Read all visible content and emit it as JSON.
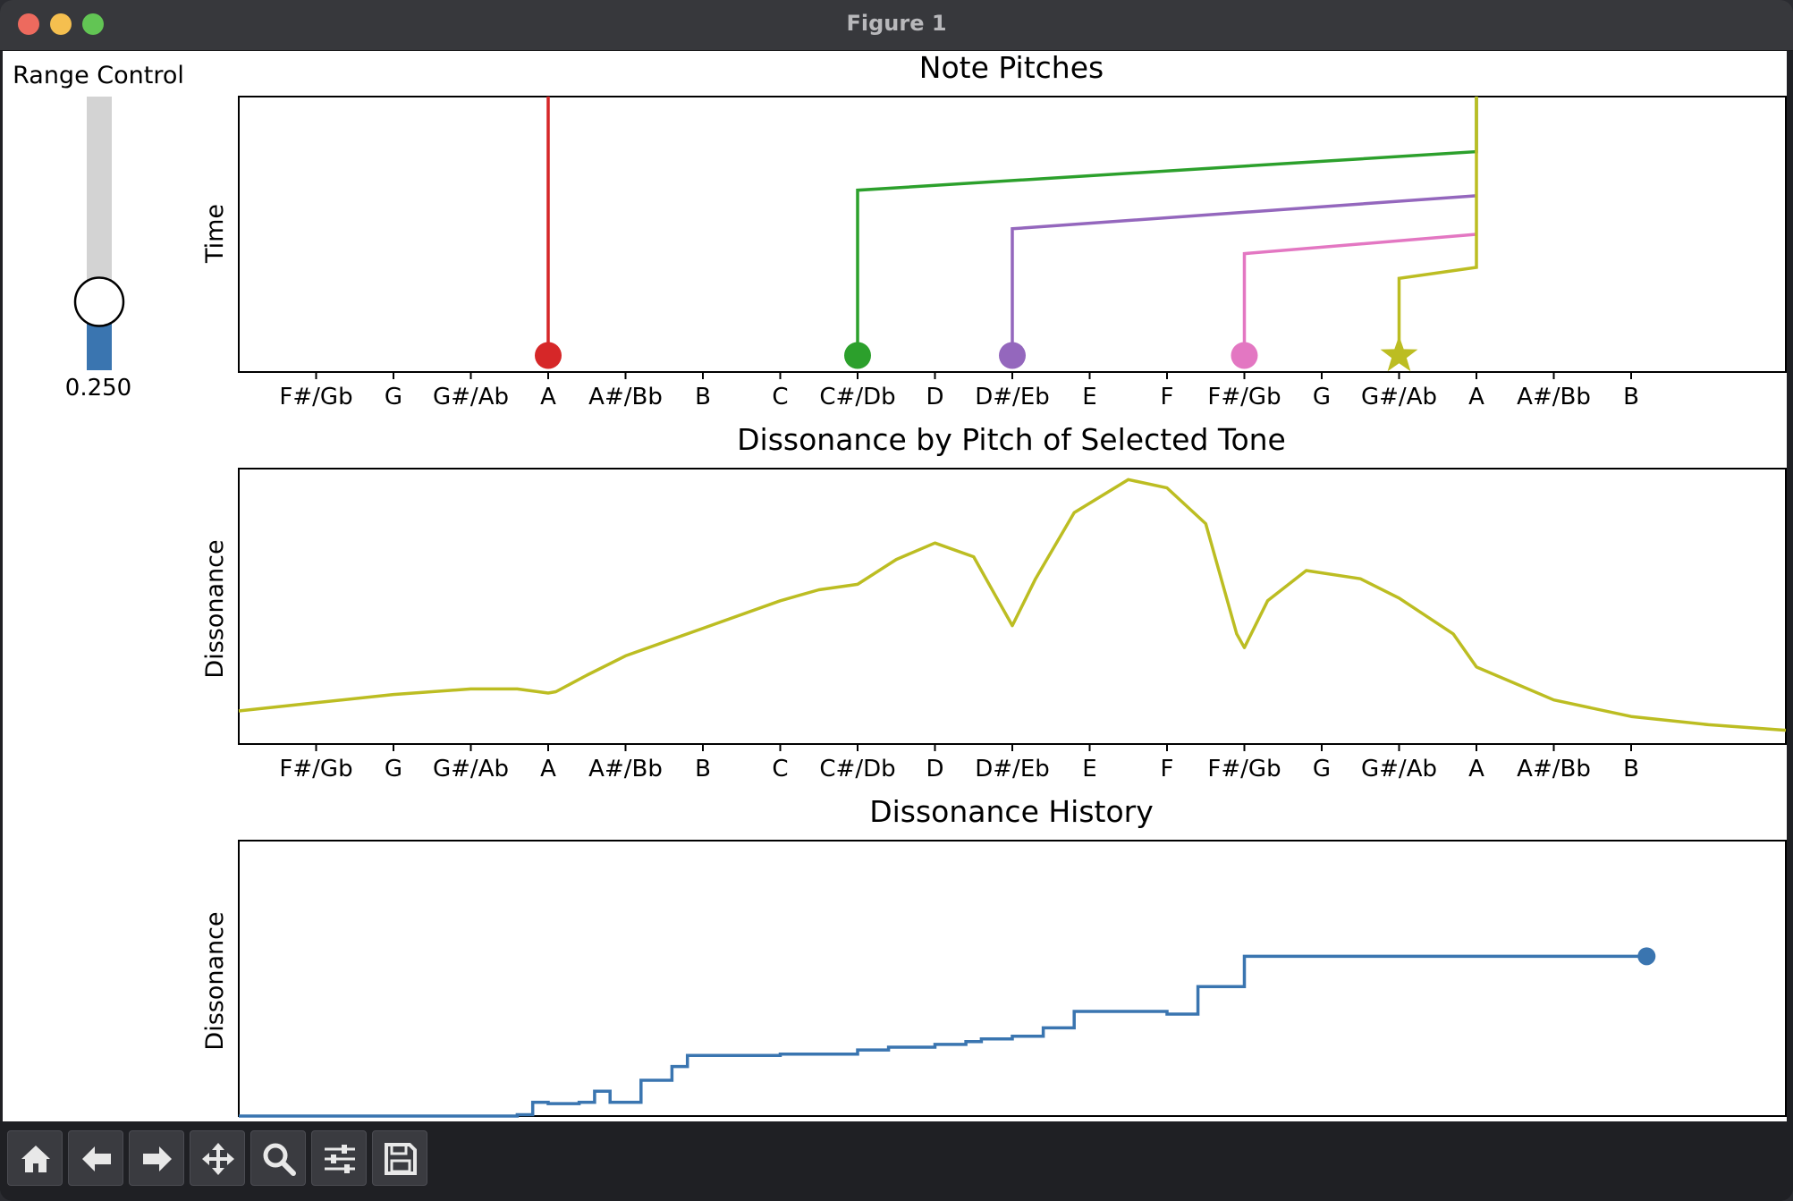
{
  "window": {
    "title": "Figure 1"
  },
  "slider": {
    "label": "Range Control",
    "value_text": "0.250",
    "value": 0.25,
    "track_color": "#d3d3d3",
    "fill_color": "#3a75b0"
  },
  "pitch_labels": [
    "F#/Gb",
    "G",
    "G#/Ab",
    "A",
    "A#/Bb",
    "B",
    "C",
    "C#/Db",
    "D",
    "D#/Eb",
    "E",
    "F",
    "F#/Gb",
    "G",
    "G#/Ab",
    "A",
    "A#/Bb",
    "B"
  ],
  "axes": {
    "note_pitches": {
      "title": "Note Pitches",
      "ylabel": "Time"
    },
    "dissonance_by_pitch": {
      "title": "Dissonance by Pitch of Selected Tone",
      "ylabel": "Dissonance"
    },
    "dissonance_history": {
      "title": "Dissonance History",
      "ylabel": "Dissonance"
    }
  },
  "chart_data": [
    {
      "type": "line",
      "title": "Note Pitches",
      "ylabel": "Time",
      "xlabel": "",
      "xlim": [
        -1,
        19
      ],
      "ylim": [
        0,
        1
      ],
      "x_ticks": [
        "F#/Gb",
        "G",
        "G#/Ab",
        "A",
        "A#/Bb",
        "B",
        "C",
        "C#/Db",
        "D",
        "D#/Eb",
        "E",
        "F",
        "F#/Gb",
        "G",
        "G#/Ab",
        "A",
        "A#/Bb",
        "B"
      ],
      "series": [
        {
          "marker": "circle",
          "color": "#d62728",
          "points": [
            [
              3,
              0.06
            ],
            [
              3,
              1.0
            ]
          ]
        },
        {
          "marker": "circle",
          "color": "#2ca02c",
          "points": [
            [
              7,
              0.06
            ],
            [
              7,
              0.66
            ],
            [
              15,
              0.8
            ],
            [
              15,
              1.0
            ]
          ]
        },
        {
          "marker": "circle",
          "color": "#9467bd",
          "points": [
            [
              9,
              0.06
            ],
            [
              9,
              0.52
            ],
            [
              15,
              0.64
            ]
          ]
        },
        {
          "marker": "circle",
          "color": "#e377c2",
          "points": [
            [
              12,
              0.06
            ],
            [
              12,
              0.43
            ],
            [
              15,
              0.5
            ]
          ]
        },
        {
          "marker": "star",
          "color": "#bcbd22",
          "points": [
            [
              14,
              0.06
            ],
            [
              14,
              0.34
            ],
            [
              15,
              0.38
            ],
            [
              15,
              1.0
            ]
          ]
        }
      ]
    },
    {
      "type": "line",
      "title": "Dissonance by Pitch of Selected Tone",
      "ylabel": "Dissonance",
      "xlabel": "",
      "xlim": [
        -1,
        19
      ],
      "ylim": [
        0,
        1
      ],
      "x_ticks": [
        "F#/Gb",
        "G",
        "G#/Ab",
        "A",
        "A#/Bb",
        "B",
        "C",
        "C#/Db",
        "D",
        "D#/Eb",
        "E",
        "F",
        "F#/Gb",
        "G",
        "G#/Ab",
        "A",
        "A#/Bb",
        "B"
      ],
      "series": [
        {
          "color": "#bcbd22",
          "points": [
            [
              -1,
              0.12
            ],
            [
              0,
              0.15
            ],
            [
              1,
              0.18
            ],
            [
              2,
              0.2
            ],
            [
              2.6,
              0.2
            ],
            [
              3,
              0.185
            ],
            [
              3.1,
              0.19
            ],
            [
              3.5,
              0.25
            ],
            [
              4,
              0.32
            ],
            [
              5,
              0.42
            ],
            [
              6,
              0.52
            ],
            [
              6.5,
              0.56
            ],
            [
              7,
              0.58
            ],
            [
              7.5,
              0.67
            ],
            [
              8,
              0.73
            ],
            [
              8.5,
              0.68
            ],
            [
              8.8,
              0.53
            ],
            [
              9,
              0.43
            ],
            [
              9.3,
              0.6
            ],
            [
              9.8,
              0.84
            ],
            [
              10.5,
              0.96
            ],
            [
              11,
              0.93
            ],
            [
              11.5,
              0.8
            ],
            [
              11.9,
              0.4
            ],
            [
              12,
              0.35
            ],
            [
              12.3,
              0.52
            ],
            [
              12.8,
              0.63
            ],
            [
              13.5,
              0.6
            ],
            [
              14,
              0.53
            ],
            [
              14.7,
              0.4
            ],
            [
              15,
              0.28
            ],
            [
              16,
              0.16
            ],
            [
              17,
              0.1
            ],
            [
              18,
              0.07
            ],
            [
              19,
              0.05
            ]
          ]
        }
      ]
    },
    {
      "type": "line",
      "title": "Dissonance History",
      "ylabel": "Dissonance",
      "xlabel": "",
      "ylim": [
        0,
        1
      ],
      "series": [
        {
          "color": "#3a75b0",
          "step": true,
          "points": [
            [
              0,
              0.0
            ],
            [
              0.15,
              0.0
            ],
            [
              0.18,
              0.005
            ],
            [
              0.19,
              0.05
            ],
            [
              0.2,
              0.045
            ],
            [
              0.22,
              0.05
            ],
            [
              0.23,
              0.09
            ],
            [
              0.24,
              0.05
            ],
            [
              0.26,
              0.13
            ],
            [
              0.28,
              0.18
            ],
            [
              0.29,
              0.22
            ],
            [
              0.3,
              0.22
            ],
            [
              0.35,
              0.225
            ],
            [
              0.4,
              0.24
            ],
            [
              0.42,
              0.25
            ],
            [
              0.45,
              0.26
            ],
            [
              0.47,
              0.27
            ],
            [
              0.48,
              0.28
            ],
            [
              0.5,
              0.29
            ],
            [
              0.52,
              0.32
            ],
            [
              0.54,
              0.38
            ],
            [
              0.6,
              0.37
            ],
            [
              0.62,
              0.47
            ],
            [
              0.65,
              0.58
            ],
            [
              0.91,
              0.58
            ]
          ],
          "end_marker": "circle"
        }
      ]
    }
  ],
  "toolbar": {
    "buttons": [
      {
        "name": "home",
        "icon": "home-icon"
      },
      {
        "name": "back",
        "icon": "arrow-left-icon"
      },
      {
        "name": "forward",
        "icon": "arrow-right-icon"
      },
      {
        "name": "pan",
        "icon": "move-icon"
      },
      {
        "name": "zoom",
        "icon": "magnifier-icon"
      },
      {
        "name": "configure-subplots",
        "icon": "sliders-icon"
      },
      {
        "name": "save",
        "icon": "floppy-disk-icon"
      }
    ]
  }
}
